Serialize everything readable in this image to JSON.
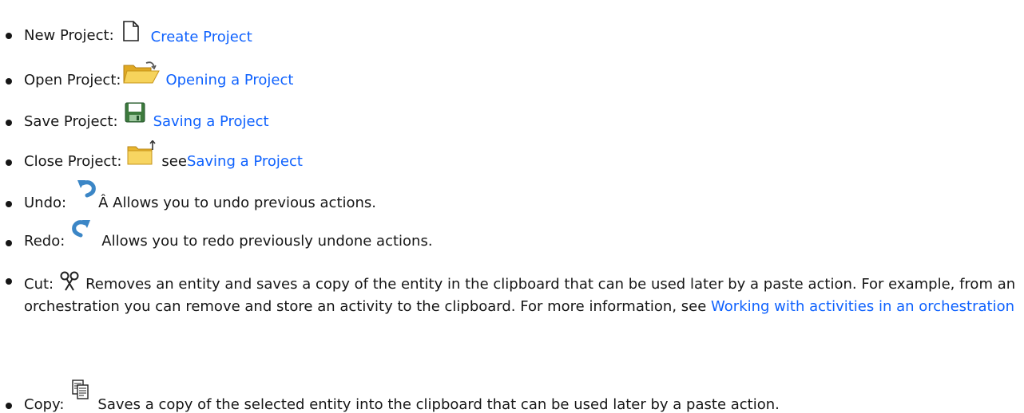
{
  "items": [
    {
      "label": "New Project:",
      "icon": "new-document-icon",
      "link": "Create Project"
    },
    {
      "label": "Open Project:",
      "icon": "open-folder-icon",
      "link": "Opening a Project"
    },
    {
      "label": "Save Project:",
      "icon": "save-floppy-icon",
      "link": "Saving a Project"
    },
    {
      "label": "Close Project:",
      "icon": "close-folder-icon",
      "prefix": "see",
      "link": "Saving a Project"
    },
    {
      "label": "Undo:",
      "icon": "undo-arrow-icon",
      "text": "Â Allows you to undo previous actions."
    },
    {
      "label": "Redo:",
      "icon": "redo-arrow-icon",
      "text": "Allows you to redo previously undone actions."
    },
    {
      "label": "Cut:",
      "icon": "scissors-icon",
      "text": "Removes an entity and saves a copy of the entity in the clipboard that can be used later by a paste action. For example, from an orchestration you can remove and store an activity to the clipboard. For more information, see",
      "link": "Working with activities in an orchestration"
    },
    {
      "label": "Copy:",
      "icon": "copy-icon",
      "text": "Saves a copy of the selected entity into the clipboard that can be used later by a paste action."
    }
  ],
  "colors": {
    "link": "#0f62fe",
    "text": "#161616",
    "folder": "#f3c84a",
    "save": "#3d7a3d",
    "arrow": "#3b86c6"
  }
}
